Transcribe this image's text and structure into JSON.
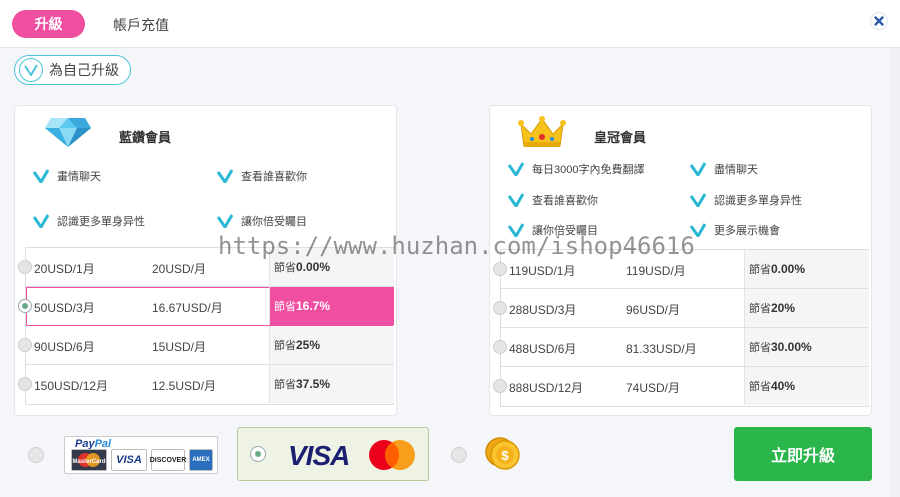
{
  "tabs": {
    "upgrade": "升級",
    "topup": "帳戶充值"
  },
  "self_upgrade_label": "為自己升級",
  "plans": {
    "blue_diamond": {
      "title": "藍鑽會員",
      "features": [
        "畫情聊天",
        "查看誰喜歡你",
        "認識更多單身异性",
        "讓你倍受矚目"
      ],
      "prices": [
        {
          "period": "20USD/1月",
          "monthly": "20USD/月",
          "save_prefix": "節省",
          "save_value": "0.00%",
          "selected": false
        },
        {
          "period": "50USD/3月",
          "monthly": "16.67USD/月",
          "save_prefix": "節省",
          "save_value": "16.7%",
          "selected": true
        },
        {
          "period": "90USD/6月",
          "monthly": "15USD/月",
          "save_prefix": "節省",
          "save_value": "25%",
          "selected": false
        },
        {
          "period": "150USD/12月",
          "monthly": "12.5USD/月",
          "save_prefix": "節省",
          "save_value": "37.5%",
          "selected": false
        }
      ]
    },
    "crown": {
      "title": "皇冠會員",
      "features": [
        "每日3000字內免費翻譯",
        "盡情聊天",
        "查看誰喜歡你",
        "認識更多單身异性",
        "讓你倍受矚目",
        "更多展示機會"
      ],
      "prices": [
        {
          "period": "119USD/1月",
          "monthly": "119USD/月",
          "save_prefix": "節省",
          "save_value": "0.00%",
          "selected": false
        },
        {
          "period": "288USD/3月",
          "monthly": "96USD/月",
          "save_prefix": "節省",
          "save_value": "20%",
          "selected": false
        },
        {
          "period": "488USD/6月",
          "monthly": "81.33USD/月",
          "save_prefix": "節省",
          "save_value": "30.00%",
          "selected": false
        },
        {
          "period": "888USD/12月",
          "monthly": "74USD/月",
          "save_prefix": "節省",
          "save_value": "40%",
          "selected": false
        }
      ]
    }
  },
  "payment": {
    "paypal_label_a": "Pay",
    "paypal_label_b": "Pal",
    "cards": [
      "MasterCard",
      "VISA",
      "DISCOVER",
      "AMEX"
    ],
    "visa_label": "VISA",
    "selected_method": "visa"
  },
  "upgrade_now_label": "立即升級",
  "watermark": "https://www.huzhan.com/ishop46616",
  "colors": {
    "accent_pink": "#f04ea0",
    "teal": "#4ac4d8",
    "green": "#2bb64b"
  }
}
